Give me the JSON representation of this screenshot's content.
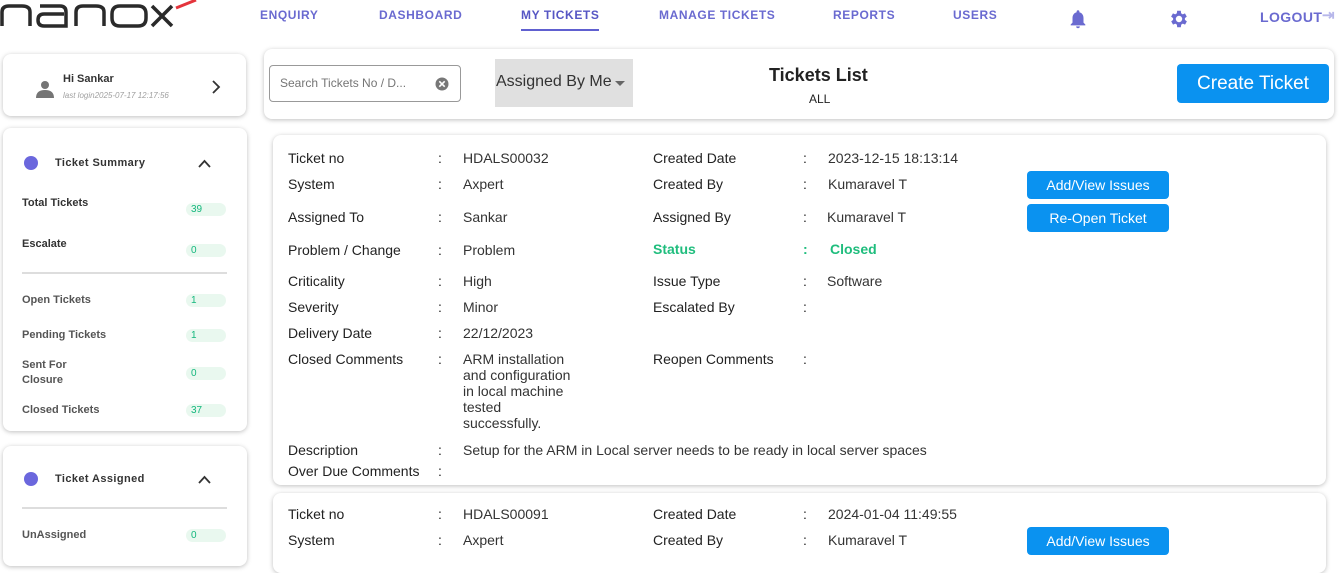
{
  "nav": {
    "enquiry": "ENQUIRY",
    "dashboard": "DASHBOARD",
    "my_tickets": "MY TICKETS",
    "manage_tickets": "MANAGE TICKETS",
    "reports": "REPORTS",
    "users": "USERS",
    "logout": "LOGOUT",
    "accent": "#6a6ad0",
    "logo_icon": "nanox-logo"
  },
  "user": {
    "greeting": "Hi Sankar",
    "last_login": "last login2025-07-17 12:17:56"
  },
  "summary": {
    "title": "Ticket Summary",
    "total_label": "Total Tickets",
    "total_value": "39",
    "escalate_label": "Escalate",
    "escalate_value": "0",
    "open_label": "Open Tickets",
    "open_value": "1",
    "pending_label": "Pending Tickets",
    "pending_value": "1",
    "sent_label_1": "Sent For",
    "sent_label_2": "Closure",
    "sent_value": "0",
    "closed_label": "Closed Tickets",
    "closed_value": "37"
  },
  "assigned": {
    "title": "Ticket Assigned",
    "unassigned_label": "UnAssigned",
    "unassigned_value": "0"
  },
  "toolbar": {
    "search_placeholder": "Search Tickets No / D...",
    "filter_value": "Assigned By Me",
    "list_title": "Tickets List",
    "list_sub": "ALL",
    "create_label": "Create Ticket"
  },
  "labels": {
    "ticket_no": "Ticket no",
    "system": "System",
    "assigned_to": "Assigned To",
    "problem_change": "Problem / Change",
    "criticality": "Criticality",
    "severity": "Severity",
    "delivery_date": "Delivery Date",
    "closed_comments": "Closed Comments",
    "description": "Description",
    "over_due": "Over Due Comments",
    "created_date": "Created Date",
    "created_by": "Created By",
    "assigned_by": "Assigned By",
    "status": "Status",
    "issue_type": "Issue Type",
    "escalated_by": "Escalated By",
    "reopen_comments": "Reopen Comments",
    "colon": ":",
    "add_view": "Add/View Issues",
    "reopen": "Re-Open Ticket"
  },
  "tickets": [
    {
      "ticket_no": "HDALS00032",
      "system": "Axpert",
      "assigned_to": "Sankar",
      "problem_change": "Problem",
      "criticality": "High",
      "severity": "Minor",
      "delivery_date": "22/12/2023",
      "closed_comments_1": "ARM installation",
      "closed_comments_2": "and configuration",
      "closed_comments_3": "in local machine",
      "closed_comments_4": "tested",
      "closed_comments_5": "successfully.",
      "description": "Setup for the ARM in Local server needs to be ready in local server spaces",
      "created_date": "2023-12-15 18:13:14",
      "created_by": "Kumaravel T",
      "assigned_by": "Kumaravel T",
      "status": "Closed",
      "status_color": "#1fbd7d",
      "issue_type": "Software"
    },
    {
      "ticket_no": "HDALS00091",
      "system": "Axpert",
      "created_date": "2024-01-04 11:49:55",
      "created_by": "Kumaravel T"
    }
  ]
}
